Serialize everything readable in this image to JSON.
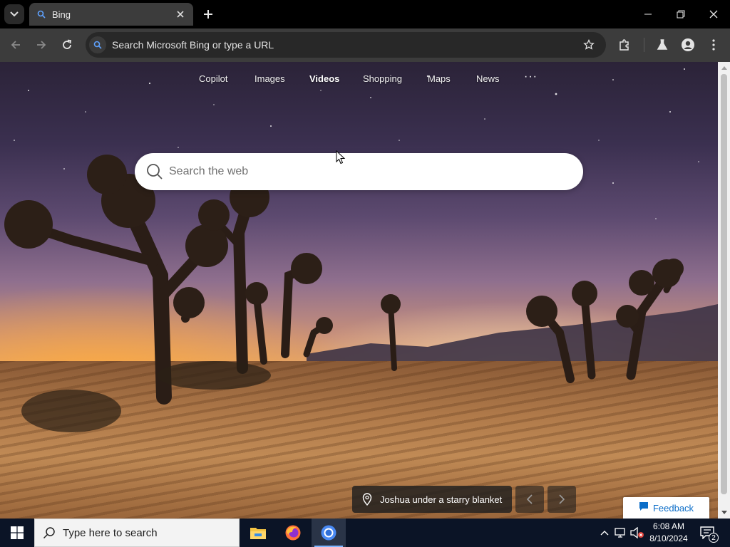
{
  "browser": {
    "tab": {
      "title": "Bing"
    },
    "address_bar": {
      "text": "Search Microsoft Bing or type a URL"
    }
  },
  "bing": {
    "nav": [
      {
        "label": "Copilot",
        "active": false
      },
      {
        "label": "Images",
        "active": false
      },
      {
        "label": "Videos",
        "active": true
      },
      {
        "label": "Shopping",
        "active": false
      },
      {
        "label": "Maps",
        "active": false
      },
      {
        "label": "News",
        "active": false
      }
    ],
    "more_label": "···",
    "search_placeholder": "Search the web",
    "caption": "Joshua under a starry blanket",
    "feedback_label": "Feedback"
  },
  "taskbar": {
    "search_placeholder": "Type here to search",
    "apps": [
      "file-explorer-icon",
      "firefox-icon",
      "chrome-icon"
    ],
    "time": "6:08 AM",
    "date": "8/10/2024",
    "notification_count": "2"
  },
  "colors": {
    "accent": "#0c6ec8",
    "taskbar_bg": "#0b1426",
    "toolbar_bg": "#3c3c3c"
  }
}
